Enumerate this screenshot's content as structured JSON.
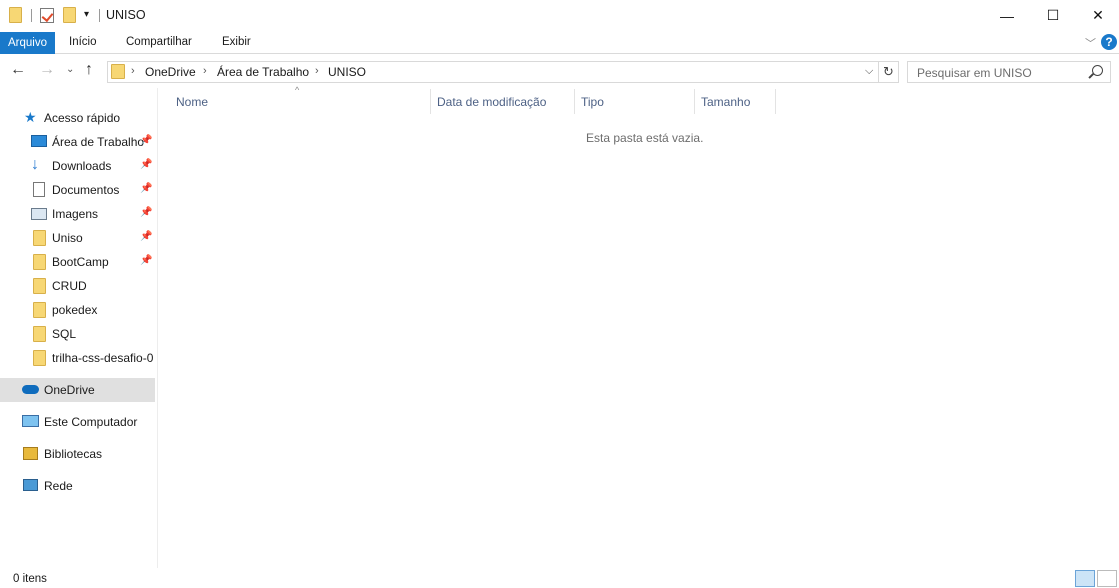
{
  "window": {
    "title": "UNISO",
    "controls": {
      "minimize": "—",
      "maximize": "☐",
      "close": "✕"
    }
  },
  "ribbon": {
    "tabs": [
      "Arquivo",
      "Início",
      "Compartilhar",
      "Exibir"
    ],
    "help": "?"
  },
  "address": {
    "crumbs": [
      "OneDrive",
      "Área de Trabalho",
      "UNISO"
    ],
    "separator": "›"
  },
  "search": {
    "placeholder": "Pesquisar em UNISO"
  },
  "sidebar": {
    "quick_access": "Acesso rápido",
    "items": [
      {
        "label": "Área de Trabalho",
        "icon": "desktop-icon",
        "pinned": true
      },
      {
        "label": "Downloads",
        "icon": "download-icon",
        "pinned": true
      },
      {
        "label": "Documentos",
        "icon": "documents-icon",
        "pinned": true
      },
      {
        "label": "Imagens",
        "icon": "pictures-icon",
        "pinned": true
      },
      {
        "label": "Uniso",
        "icon": "folder-icon",
        "pinned": true
      },
      {
        "label": "BootCamp",
        "icon": "folder-icon",
        "pinned": true
      },
      {
        "label": "CRUD",
        "icon": "folder-icon",
        "pinned": false
      },
      {
        "label": "pokedex",
        "icon": "folder-icon",
        "pinned": false
      },
      {
        "label": "SQL",
        "icon": "folder-icon",
        "pinned": false
      },
      {
        "label": "trilha-css-desafio-0",
        "icon": "folder-icon",
        "pinned": false
      }
    ],
    "onedrive": "OneDrive",
    "this_pc": "Este Computador",
    "libraries": "Bibliotecas",
    "network": "Rede"
  },
  "columns": [
    "Nome",
    "Data de modificação",
    "Tipo",
    "Tamanho"
  ],
  "main": {
    "empty_message": "Esta pasta está vazia."
  },
  "status": {
    "count": "0 itens"
  },
  "colors": {
    "accent": "#1979ca",
    "selected": "#e0e0e0",
    "folder": "#f7d774"
  }
}
